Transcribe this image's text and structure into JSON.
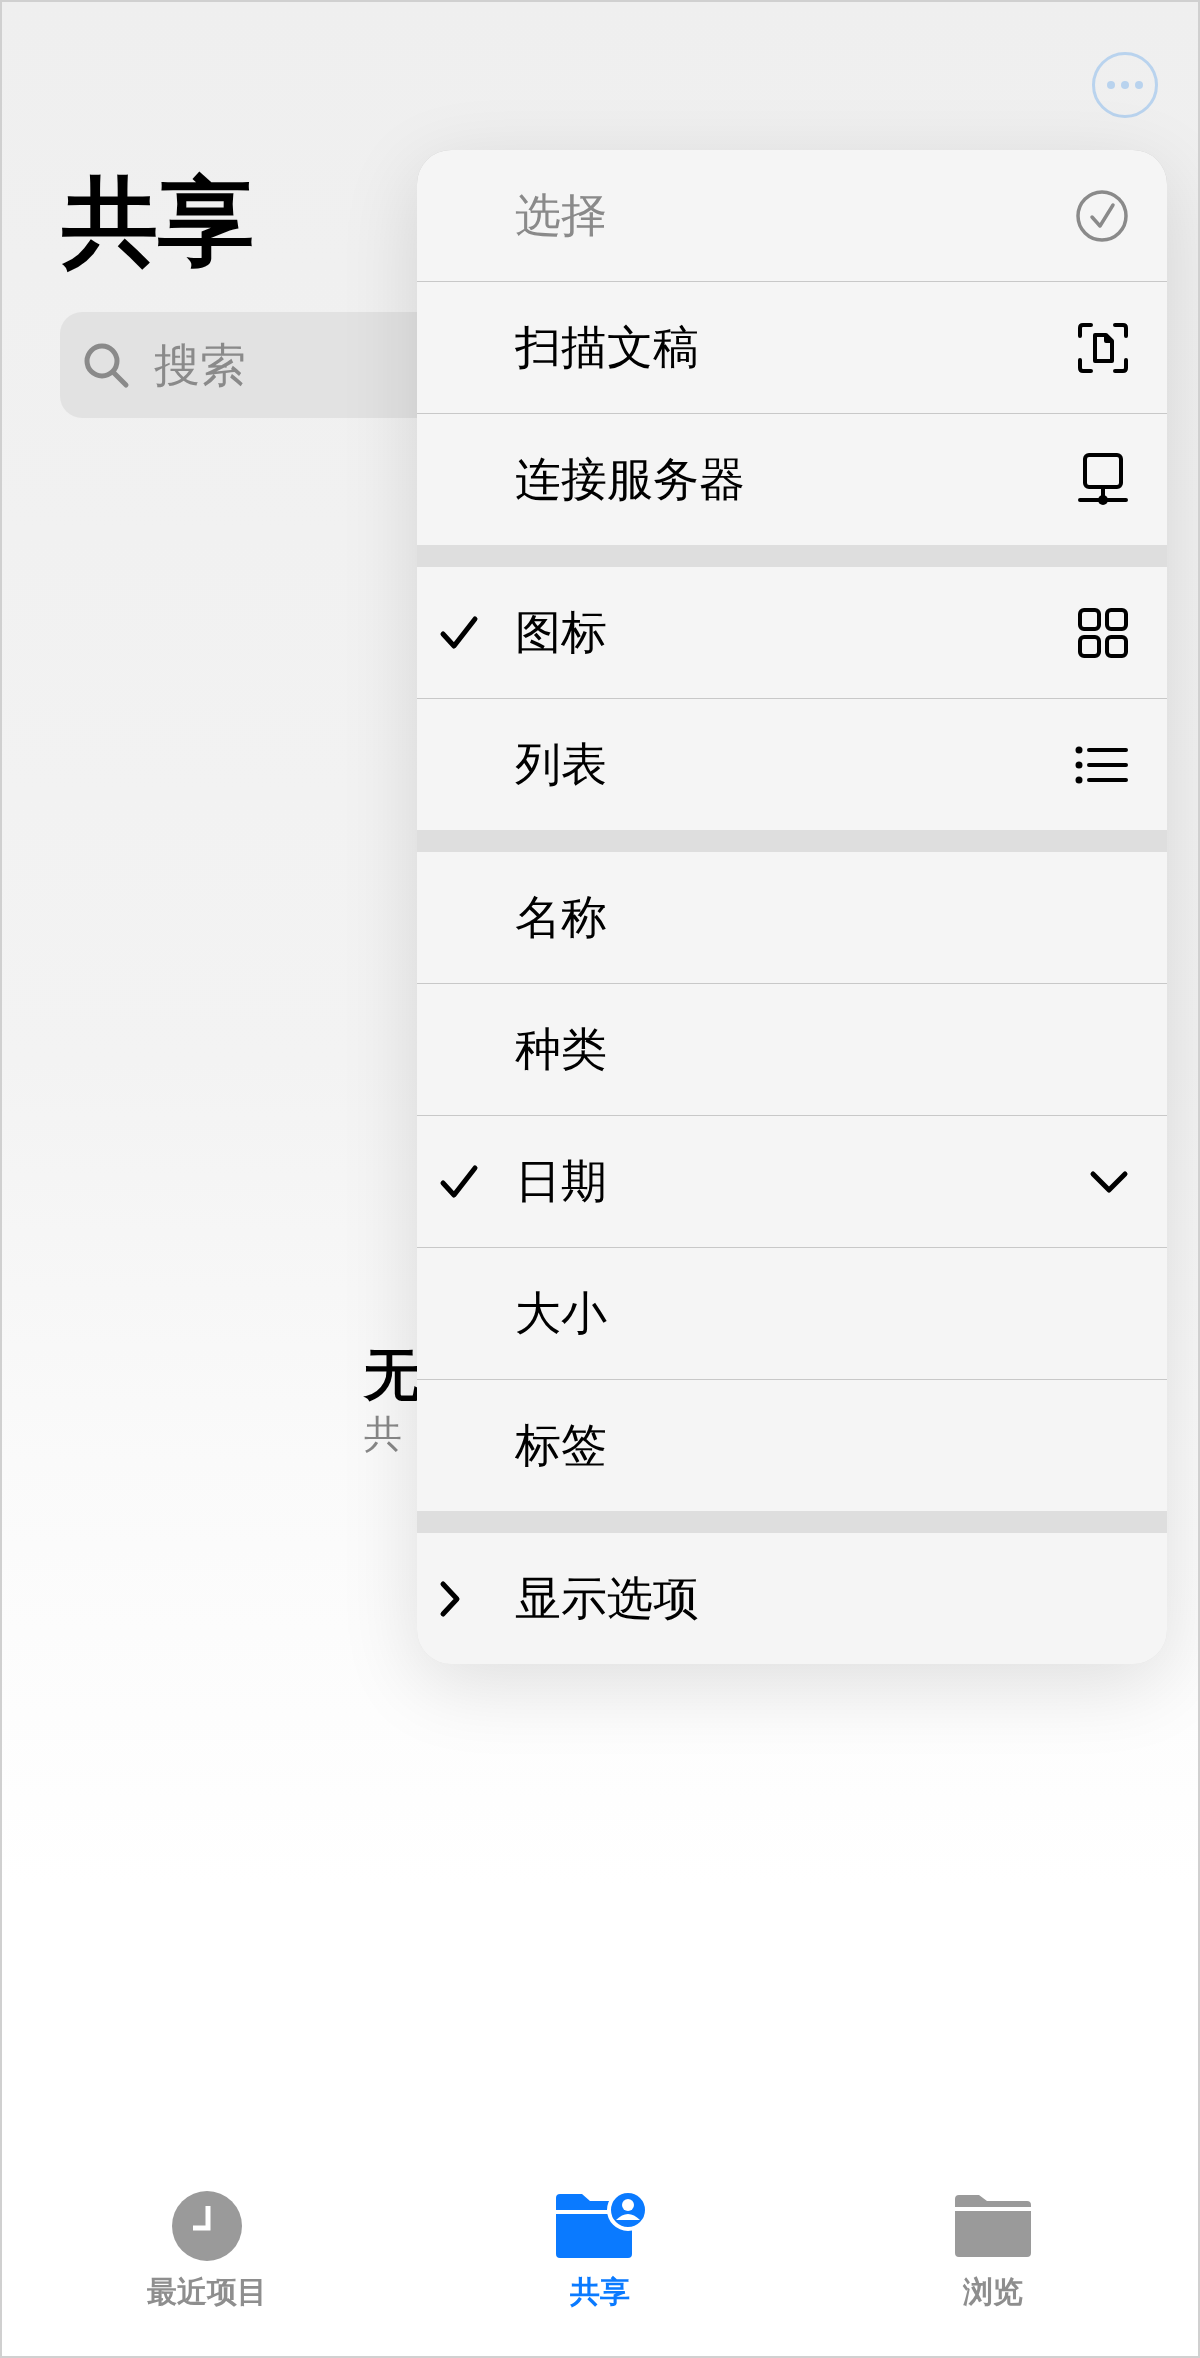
{
  "title": "共享",
  "search": {
    "placeholder": "搜索"
  },
  "empty_state": {
    "title": "无",
    "subtitle": "共"
  },
  "menu": {
    "sections": [
      {
        "items": [
          {
            "kind": "action",
            "label": "选择",
            "disabled": true
          },
          {
            "kind": "action",
            "label": "扫描文稿",
            "disabled": false
          },
          {
            "kind": "action",
            "label": "连接服务器",
            "disabled": false
          }
        ]
      },
      {
        "items": [
          {
            "kind": "option",
            "label": "图标",
            "checked": true
          },
          {
            "kind": "option",
            "label": "列表",
            "checked": false
          }
        ]
      },
      {
        "items": [
          {
            "kind": "option",
            "label": "名称",
            "checked": false
          },
          {
            "kind": "option",
            "label": "种类",
            "checked": false
          },
          {
            "kind": "option",
            "label": "日期",
            "checked": true
          },
          {
            "kind": "option",
            "label": "大小",
            "checked": false
          },
          {
            "kind": "option",
            "label": "标签",
            "checked": false
          }
        ]
      },
      {
        "items": [
          {
            "kind": "submenu",
            "label": "显示选项",
            "expanded": false
          }
        ]
      }
    ]
  },
  "tabs": [
    {
      "label": "最近项目",
      "selected": false
    },
    {
      "label": "共享",
      "selected": true
    },
    {
      "label": "浏览",
      "selected": false
    }
  ]
}
